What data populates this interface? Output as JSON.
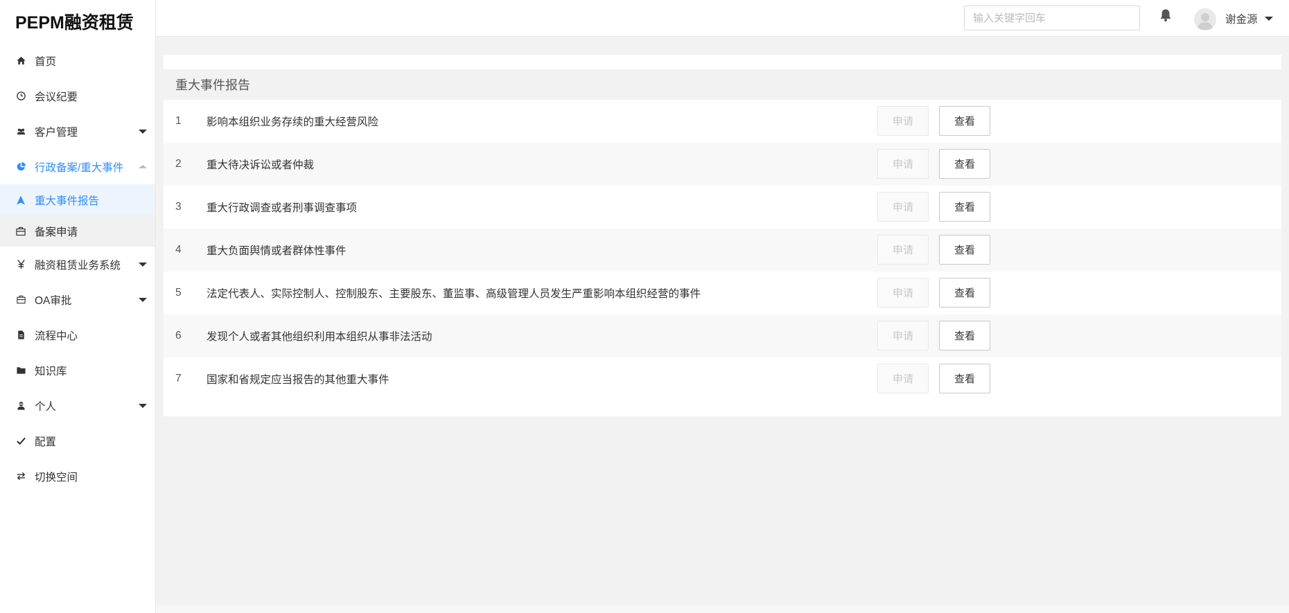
{
  "app": {
    "title": "PEPM融资租赁"
  },
  "header": {
    "search_placeholder": "输入关键字回车",
    "user_name": "谢金源",
    "bell_icon": "bell-icon",
    "avatar_icon": "user-avatar"
  },
  "sidebar": {
    "items": [
      {
        "label": "首页",
        "icon": "home-icon"
      },
      {
        "label": "会议纪要",
        "icon": "clock-icon"
      },
      {
        "label": "客户管理",
        "icon": "users-icon"
      },
      {
        "label": "行政备案/重大事件",
        "icon": "pie-chart-icon"
      },
      {
        "label": "融资租赁业务系统",
        "icon": "yen-icon"
      },
      {
        "label": "OA审批",
        "icon": "briefcase-icon"
      },
      {
        "label": "流程中心",
        "icon": "file-icon"
      },
      {
        "label": "知识库",
        "icon": "folder-icon"
      },
      {
        "label": "个人",
        "icon": "person-icon"
      },
      {
        "label": "配置",
        "icon": "check-icon"
      },
      {
        "label": "切换空间",
        "icon": "swap-icon"
      }
    ],
    "submenu": [
      {
        "label": "重大事件报告",
        "icon": "navigation-icon"
      },
      {
        "label": "备案申请",
        "icon": "briefcase-icon"
      }
    ]
  },
  "main": {
    "panel_title": "重大事件报告",
    "apply_label": "申请",
    "view_label": "查看",
    "rows": [
      {
        "index": "1",
        "title": "影响本组织业务存续的重大经营风险"
      },
      {
        "index": "2",
        "title": "重大待决诉讼或者仲裁"
      },
      {
        "index": "3",
        "title": "重大行政调查或者刑事调查事项"
      },
      {
        "index": "4",
        "title": "重大负面舆情或者群体性事件"
      },
      {
        "index": "5",
        "title": "法定代表人、实际控制人、控制股东、主要股东、董监事、高级管理人员发生严重影响本组织经营的事件"
      },
      {
        "index": "6",
        "title": "发现个人或者其他组织利用本组织从事非法活动"
      },
      {
        "index": "7",
        "title": "国家和省规定应当报告的其他重大事件"
      }
    ]
  },
  "colors": {
    "accent": "#2f8ff7",
    "active_bg": "#eef4fb"
  }
}
